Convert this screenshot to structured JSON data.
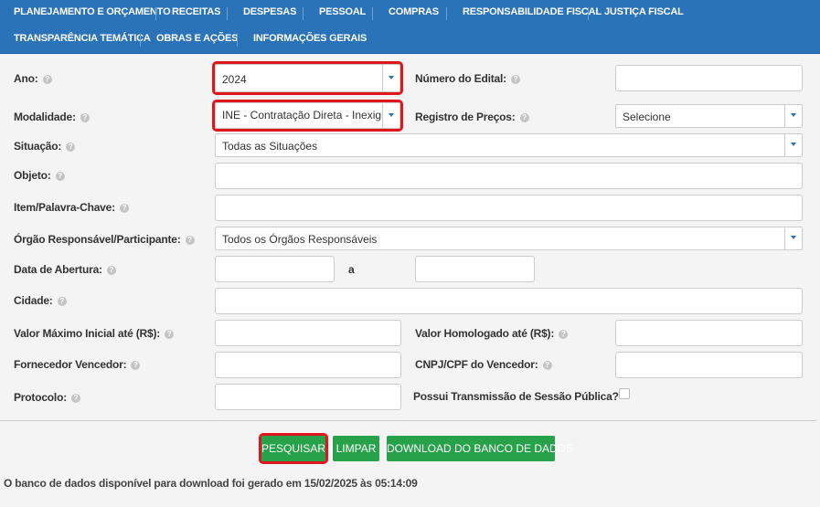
{
  "nav": {
    "items": [
      "PLANEJAMENTO E ORÇAMENTO",
      "RECEITAS",
      "DESPESAS",
      "PESSOAL",
      "COMPRAS",
      "RESPONSABILIDADE FISCAL",
      "JUSTIÇA FISCAL",
      "TRANSPARÊNCIA TEMÁTICA",
      "OBRAS E AÇÕES",
      "INFORMAÇÕES GERAIS"
    ]
  },
  "form": {
    "ano_label": "Ano:",
    "ano_value": "2024",
    "numero_edital_label": "Número do Edital:",
    "modalidade_label": "Modalidade:",
    "modalidade_value": "INE - Contratação Direta - Inexigibilidade",
    "registro_precos_label": "Registro de Preços:",
    "registro_precos_value": "Selecione",
    "situacao_label": "Situação:",
    "situacao_value": "Todas as Situações",
    "objeto_label": "Objeto:",
    "item_label": "Item/Palavra-Chave:",
    "orgao_label": "Órgão Responsável/Participante:",
    "orgao_value": "Todos os Órgãos Responsáveis",
    "data_abertura_label": "Data de Abertura:",
    "data_a_label": "a",
    "cidade_label": "Cidade:",
    "valor_maximo_label": "Valor Máximo Inicial até (R$):",
    "valor_homologado_label": "Valor Homologado até (R$):",
    "fornecedor_label": "Fornecedor Vencedor:",
    "cnpj_label": "CNPJ/CPF do Vencedor:",
    "protocolo_label": "Protocolo:",
    "transmissao_label": "Possui Transmissão de Sessão Pública?"
  },
  "buttons": {
    "pesquisar": "PESQUISAR",
    "limpar": "LIMPAR",
    "download": "DOWNLOAD DO BANCO DE DADOS"
  },
  "footer": {
    "text": "O banco de dados disponível para download foi gerado em 15/02/2025 às 05:14:09"
  },
  "help_glyph": "?",
  "colors": {
    "nav": "#2a73b8",
    "button": "#27a24a",
    "highlight": "#e0161e"
  }
}
